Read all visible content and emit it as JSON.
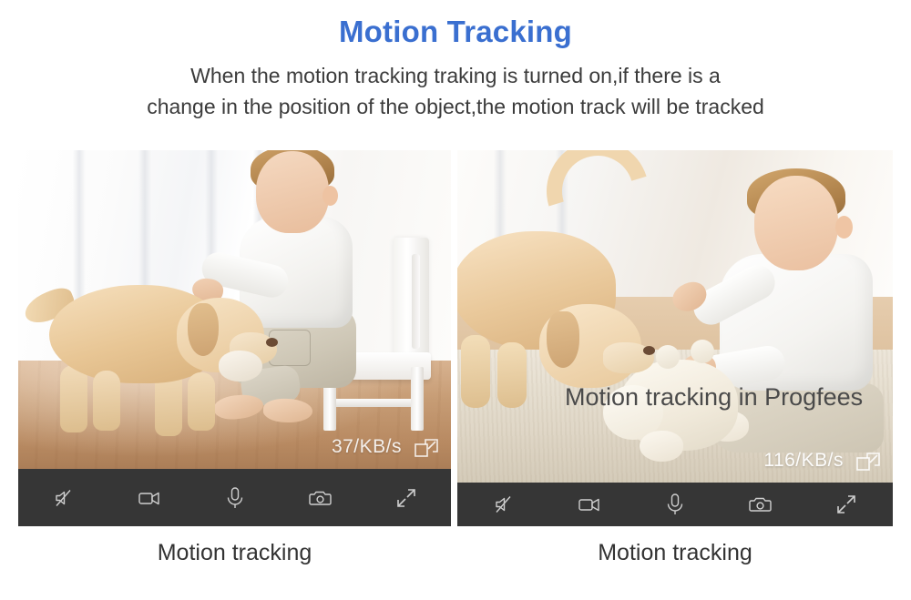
{
  "header": {
    "title": "Motion Tracking",
    "subtitle_line1": "When the motion tracking traking is turned on,if there is a",
    "subtitle_line2": "change in the position of the object,the motion track will be tracked",
    "title_color": "#3a6fd0"
  },
  "colors": {
    "title_blue": "#3a6fd0",
    "controlbar_dark": "#363636",
    "caption_text": "#333333",
    "page_background": "#ffffff"
  },
  "panels": [
    {
      "id": "left",
      "bitrate": "37/KB/s",
      "overlay_label": "",
      "caption": "Motion tracking",
      "controls": [
        {
          "name": "mute-speaker-icon",
          "label": "Mute"
        },
        {
          "name": "video-record-icon",
          "label": "Record video"
        },
        {
          "name": "microphone-icon",
          "label": "Talk"
        },
        {
          "name": "snapshot-camera-icon",
          "label": "Snapshot"
        },
        {
          "name": "fullscreen-expand-icon",
          "label": "Fullscreen"
        }
      ],
      "resize_icon": "resize-window-icon"
    },
    {
      "id": "right",
      "bitrate": "116/KB/s",
      "overlay_label": "Motion tracking in Progfees",
      "caption": "Motion tracking",
      "controls": [
        {
          "name": "mute-speaker-icon",
          "label": "Mute"
        },
        {
          "name": "video-record-icon",
          "label": "Record video"
        },
        {
          "name": "microphone-icon",
          "label": "Talk"
        },
        {
          "name": "snapshot-camera-icon",
          "label": "Snapshot"
        },
        {
          "name": "fullscreen-expand-icon",
          "label": "Fullscreen"
        }
      ],
      "resize_icon": "resize-window-icon"
    }
  ]
}
